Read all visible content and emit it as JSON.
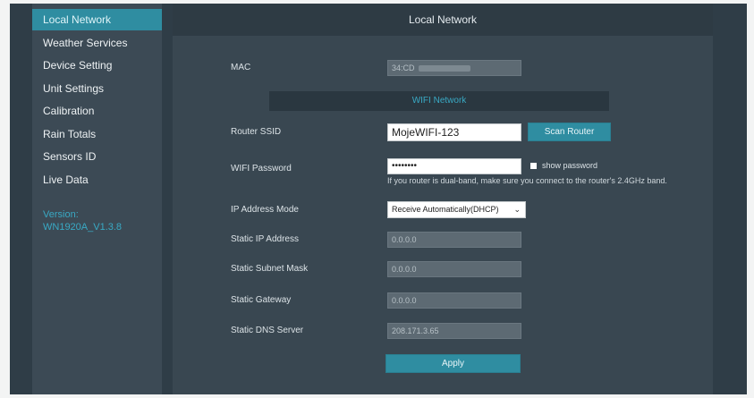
{
  "sidebar": {
    "items": [
      {
        "label": "Local Network",
        "active": true
      },
      {
        "label": "Weather Services"
      },
      {
        "label": "Device Setting"
      },
      {
        "label": "Unit Settings"
      },
      {
        "label": "Calibration"
      },
      {
        "label": "Rain Totals"
      },
      {
        "label": "Sensors ID"
      },
      {
        "label": "Live Data"
      }
    ],
    "version_label": "Version:",
    "version_value": "WN1920A_V1.3.8"
  },
  "main": {
    "title": "Local Network",
    "mac": {
      "label": "MAC",
      "value": "34:CD"
    },
    "wifi_section": "WIFI Network",
    "ssid": {
      "label": "Router SSID",
      "value": "MojeWIFI-123"
    },
    "scan_button": "Scan Router",
    "password": {
      "label": "WIFI Password",
      "value": "••••••••",
      "show_label": "show password"
    },
    "hint": "If you router is dual-band, make sure you connect to the router's 2.4GHz band.",
    "ip_mode": {
      "label": "IP Address Mode",
      "value": "Receive Automatically(DHCP)"
    },
    "static_ip": {
      "label": "Static IP Address",
      "value": "0.0.0.0"
    },
    "subnet": {
      "label": "Static Subnet Mask",
      "value": "0.0.0.0"
    },
    "gateway": {
      "label": "Static Gateway",
      "value": "0.0.0.0"
    },
    "dns": {
      "label": "Static DNS Server",
      "value": "208.171.3.65"
    },
    "apply_button": "Apply"
  },
  "colors": {
    "accent": "#2f8da1",
    "sidebar_bg": "#3c4a55",
    "main_bg": "#394751",
    "version_text": "#39a9c4"
  }
}
